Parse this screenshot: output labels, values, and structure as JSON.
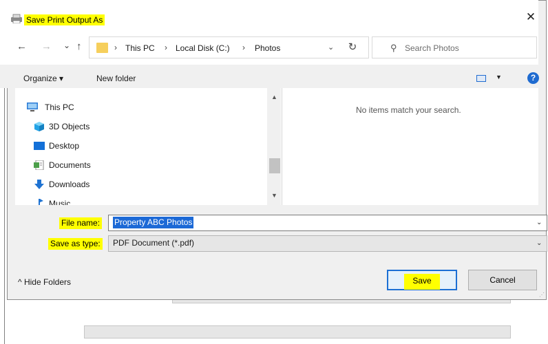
{
  "window": {
    "title": "Save Print Output As",
    "close_glyph": "✕"
  },
  "nav": {
    "back_glyph": "←",
    "forward_glyph": "→",
    "recent_glyph": "⌄",
    "up_glyph": "↑",
    "crumbs": [
      "This PC",
      "Local Disk (C:)",
      "Photos"
    ],
    "crumb_sep": "›",
    "address_drop_glyph": "⌄",
    "refresh_glyph": "↻",
    "search_glyph": "⚲",
    "search_placeholder": "Search Photos"
  },
  "toolbar": {
    "organize_label": "Organize ▾",
    "new_folder_label": "New folder",
    "view_drop_glyph": "▼",
    "help_glyph": "?"
  },
  "tree": {
    "items": [
      {
        "label": "This PC",
        "icon": "monitor-icon"
      },
      {
        "label": "3D Objects",
        "icon": "cube-icon"
      },
      {
        "label": "Desktop",
        "icon": "desktop-icon"
      },
      {
        "label": "Documents",
        "icon": "documents-icon"
      },
      {
        "label": "Downloads",
        "icon": "download-arrow-icon"
      },
      {
        "label": "Music",
        "icon": "music-icon"
      }
    ],
    "scroll_up_glyph": "▲",
    "scroll_down_glyph": "▼"
  },
  "file_pane": {
    "empty_message": "No items match your search."
  },
  "form": {
    "file_name_label": "File name:",
    "file_name_value": "Property ABC Photos",
    "save_type_label": "Save as type:",
    "save_type_value": "PDF Document (*.pdf)",
    "dropdown_glyph": "⌄"
  },
  "footer": {
    "hide_folders_label": "^  Hide Folders",
    "save_label": "Save",
    "cancel_label": "Cancel",
    "grip_glyph": "⋰"
  },
  "colors": {
    "highlight": "#ffff00",
    "accent": "#1c69d6",
    "dialog_bg": "#f0f0f0"
  }
}
